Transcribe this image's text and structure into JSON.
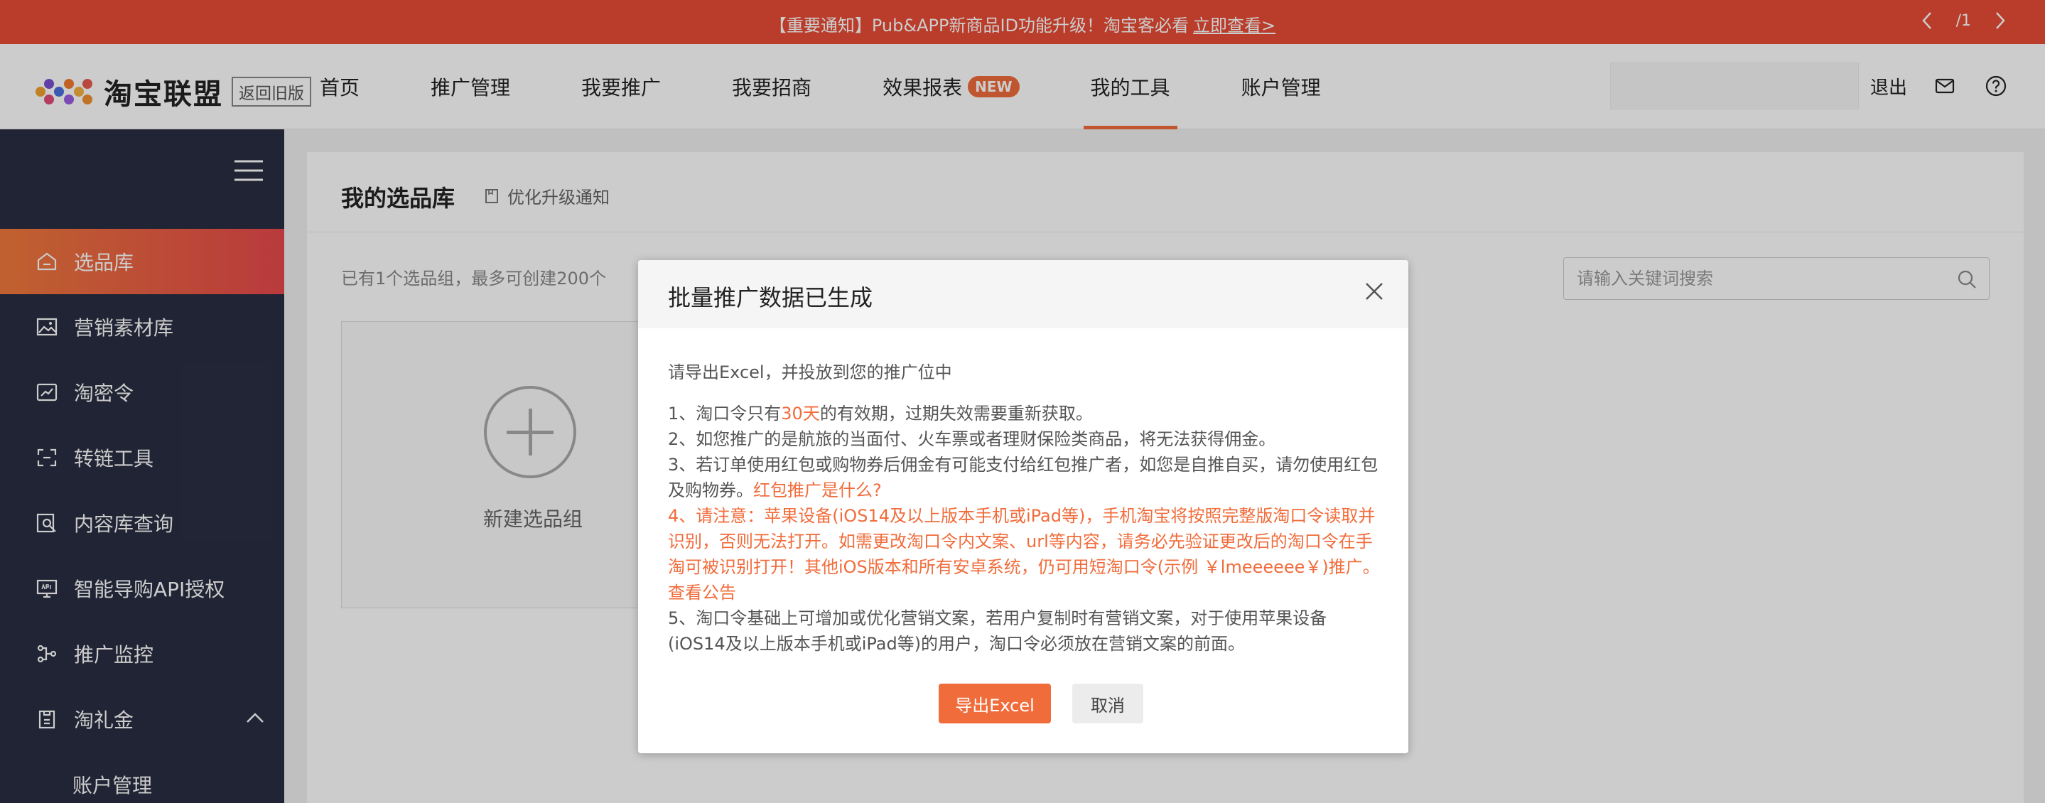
{
  "notice": {
    "message": "【重要通知】Pub&APP新商品ID功能升级！淘宝客必看",
    "link": "立即查看>",
    "page": "/1"
  },
  "header": {
    "brand": "淘宝联盟",
    "old_version": "返回旧版",
    "nav": [
      {
        "label": "首页"
      },
      {
        "label": "推广管理"
      },
      {
        "label": "我要推广"
      },
      {
        "label": "我要招商"
      },
      {
        "label": "效果报表",
        "badge": "NEW"
      },
      {
        "label": "我的工具",
        "active": true
      },
      {
        "label": "账户管理"
      }
    ],
    "logout": "退出"
  },
  "sidebar": {
    "items": [
      {
        "label": "选品库",
        "icon": "home-icon",
        "active": true
      },
      {
        "label": "营销素材库",
        "icon": "image-icon"
      },
      {
        "label": "淘密令",
        "icon": "chart-icon"
      },
      {
        "label": "转链工具",
        "icon": "link-icon"
      },
      {
        "label": "内容库查询",
        "icon": "search-doc-icon"
      },
      {
        "label": "智能导购API授权",
        "icon": "api-icon"
      },
      {
        "label": "推广监控",
        "icon": "monitor-icon"
      },
      {
        "label": "淘礼金",
        "icon": "gift-icon",
        "expanded": true
      }
    ],
    "sub_items": [
      {
        "label": "账户管理"
      }
    ]
  },
  "main": {
    "title": "我的选品库",
    "upgrade_notice": "优化升级通知",
    "summary": "已有1个选品组，最多可创建200个",
    "search_placeholder": "请输入关键词搜索",
    "new_group": "新建选品组"
  },
  "modal": {
    "title": "批量推广数据已生成",
    "intro": "请导出Excel，并投放到您的推广位中",
    "item1_a": "1、淘口令只有",
    "item1_hl": "30天",
    "item1_b": "的有效期，过期失效需要重新获取。",
    "item2": "2、如您推广的是航旅的当面付、火车票或者理财保险类商品，将无法获得佣金。",
    "item3": "3、若订单使用红包或购物券后佣金有可能支付给红包推广者，如您是自推自买，请勿使用红包及购物券。",
    "item3_link": "红包推广是什么?",
    "item4": "4、请注意：苹果设备(iOS14及以上版本手机或iPad等)，手机淘宝将按照完整版淘口令读取并识别，否则无法打开。如需更改淘口令内文案、url等内容，请务必先验证更改后的淘口令在手淘可被识别打开！其他iOS版本和所有安卓系统，仍可用短淘口令(示例 ￥lmeeeeee￥)推广。",
    "item4_link": "查看公告",
    "item5": "5、淘口令基础上可增加或优化营销文案，若用户复制时有营销文案，对于使用苹果设备(iOS14及以上版本手机或iPad等)的用户，淘口令必须放在营销文案的前面。",
    "export_label": "导出Excel",
    "cancel_label": "取消"
  },
  "colors": {
    "notice_bg": "#e94b35",
    "accent": "#f16c3b",
    "sidebar_bg": "#2a2e42"
  }
}
